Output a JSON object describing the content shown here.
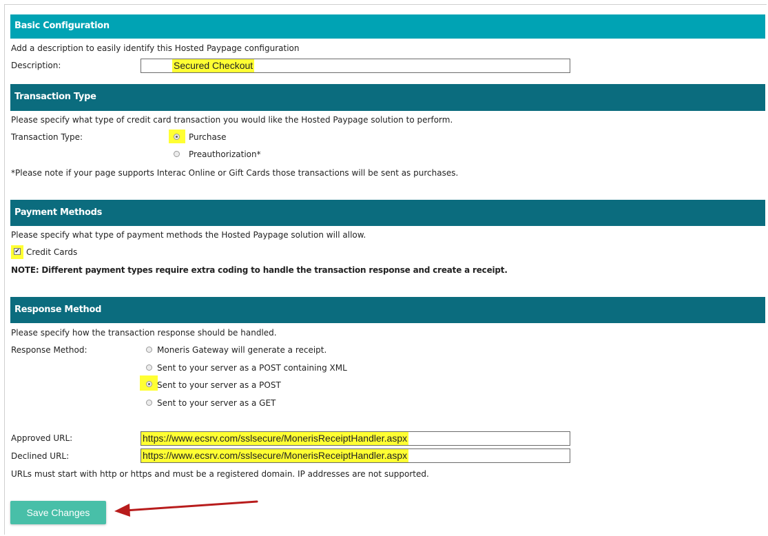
{
  "colors": {
    "header_teal": "#00a3b4",
    "header_dark": "#0b6c7e",
    "button": "#48bfa8",
    "highlight": "#ffff33",
    "arrow": "#b81c1c"
  },
  "basic": {
    "title": "Basic Configuration",
    "desc_text": "Add a description to easily identify this Hosted Paypage configuration",
    "description_label": "Description:",
    "description_value": "Secured Checkout"
  },
  "transaction": {
    "title": "Transaction Type",
    "desc_text": "Please specify what type of credit card transaction you would like the Hosted Paypage solution to perform.",
    "label": "Transaction Type:",
    "options": [
      "Purchase",
      "Preauthorization*"
    ],
    "selected": "Purchase",
    "note": "*Please note if your page supports Interac Online or Gift Cards those transactions will be sent as purchases."
  },
  "payment": {
    "title": "Payment Methods",
    "desc_text": "Please specify what type of payment methods the Hosted Paypage solution will allow.",
    "credit_cards_label": "Credit Cards",
    "credit_cards_checked": true,
    "note": "NOTE: Different payment types require extra coding to handle the transaction response and create a receipt."
  },
  "response": {
    "title": "Response Method",
    "desc_text": "Please specify how the transaction response should be handled.",
    "label": "Response Method:",
    "options": [
      "Moneris Gateway will generate a receipt.",
      "Sent to your server as a POST containing XML",
      "Sent to your server as a POST",
      "Sent to your server as a GET"
    ],
    "selected": "Sent to your server as a POST",
    "approved_label": "Approved URL:",
    "approved_value": "https://www.ecsrv.com/sslsecure/MonerisReceiptHandler.aspx",
    "declined_label": "Declined URL:",
    "declined_value": "https://www.ecsrv.com/sslsecure/MonerisReceiptHandler.aspx",
    "url_note": "URLs must start with http or https and must be a registered domain. IP addresses are not supported."
  },
  "save_label": "Save Changes"
}
